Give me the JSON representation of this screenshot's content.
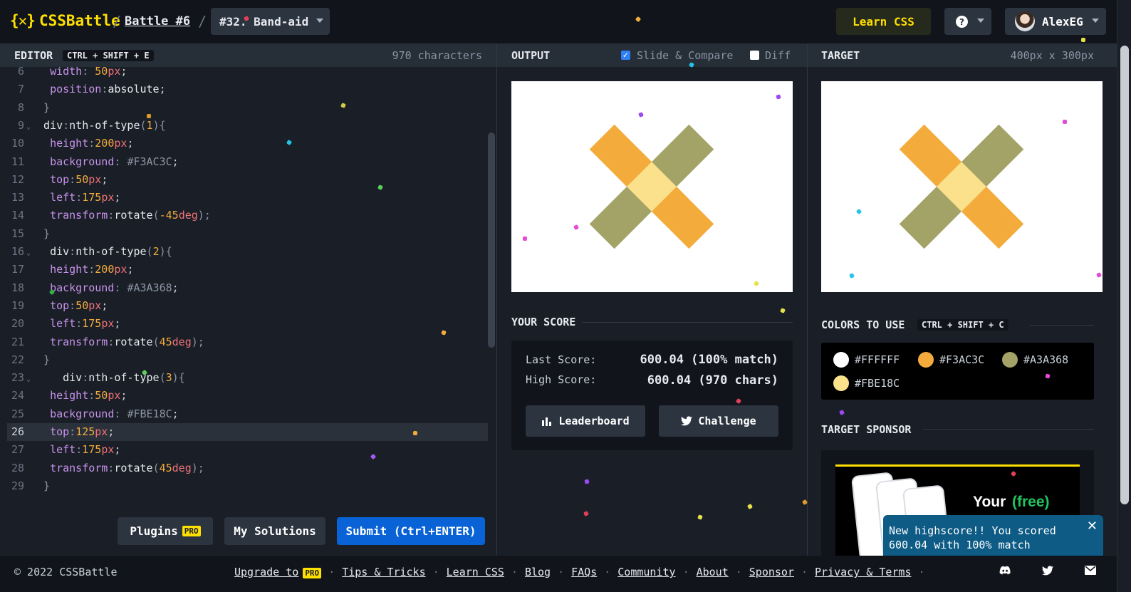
{
  "header": {
    "logo_text": "CSSBattle",
    "logo_mark": "{✕}",
    "battle_label": "Battle #6",
    "target_select": "#32. Band-aid",
    "learn_css": "Learn CSS",
    "help": "?",
    "user_name": "AlexEG"
  },
  "editor": {
    "title": "EDITOR",
    "shortcut": "CTRL + SHIFT + E",
    "char_count": "970 characters",
    "lines": [
      {
        "n": "6",
        "text": "  width: 50px;"
      },
      {
        "n": "7",
        "text": "  position:absolute;"
      },
      {
        "n": "8",
        "text": " }"
      },
      {
        "n": "9",
        "text": " div:nth-of-type(1){"
      },
      {
        "n": "10",
        "text": "  height:200px;"
      },
      {
        "n": "11",
        "text": "  background: #F3AC3C;"
      },
      {
        "n": "12",
        "text": "  top:50px;"
      },
      {
        "n": "13",
        "text": "  left:175px;"
      },
      {
        "n": "14",
        "text": "  transform:rotate(-45deg);"
      },
      {
        "n": "15",
        "text": " }"
      },
      {
        "n": "16",
        "text": "  div:nth-of-type(2){"
      },
      {
        "n": "17",
        "text": "  height:200px;"
      },
      {
        "n": "18",
        "text": "  background: #A3A368;"
      },
      {
        "n": "19",
        "text": "  top:50px;"
      },
      {
        "n": "20",
        "text": "  left:175px;"
      },
      {
        "n": "21",
        "text": "  transform:rotate(45deg);"
      },
      {
        "n": "22",
        "text": " }"
      },
      {
        "n": "23",
        "text": "    div:nth-of-type(3){"
      },
      {
        "n": "24",
        "text": "  height:50px;"
      },
      {
        "n": "25",
        "text": "  background: #FBE18C;"
      },
      {
        "n": "26",
        "text": "  top:125px;"
      },
      {
        "n": "27",
        "text": "  left:175px;"
      },
      {
        "n": "28",
        "text": "  transform:rotate(45deg);"
      },
      {
        "n": "29",
        "text": " }"
      }
    ],
    "plugins": "Plugins",
    "pro": "PRO",
    "my_solutions": "My Solutions",
    "submit": "Submit (Ctrl+ENTER)"
  },
  "output": {
    "title": "OUTPUT",
    "slide_compare": "Slide & Compare",
    "slide_checked": true,
    "diff": "Diff",
    "diff_checked": false
  },
  "target": {
    "title": "TARGET",
    "size": "400px x 300px"
  },
  "score": {
    "title": "YOUR SCORE",
    "last_label": "Last Score:",
    "last_value": "600.04 (100% match)",
    "high_label": "High Score:",
    "high_value": "600.04 (970 chars)",
    "leaderboard": "Leaderboard",
    "challenge": "Challenge"
  },
  "colors": {
    "title": "COLORS TO USE",
    "shortcut": "CTRL + SHIFT + C",
    "items": [
      {
        "hex": "#FFFFFF",
        "color": "#FFFFFF"
      },
      {
        "hex": "#F3AC3C",
        "color": "#F3AC3C"
      },
      {
        "hex": "#A3A368",
        "color": "#A3A368"
      },
      {
        "hex": "#FBE18C",
        "color": "#FBE18C"
      }
    ]
  },
  "sponsor": {
    "title": "TARGET SPONSOR",
    "ad_text": "Your",
    "ad_highlight": "(free)"
  },
  "toast": {
    "line1": "New highscore!! You scored",
    "line2": "600.04 with 100% match",
    "close": "✕"
  },
  "footer": {
    "copyright": "© 2022 CSSBattle",
    "links": [
      "Upgrade to",
      "Tips & Tricks",
      "Learn CSS",
      "Blog",
      "FAQs",
      "Community",
      "About",
      "Sponsor",
      "Privacy & Terms"
    ],
    "pro": "PRO"
  },
  "theme": {
    "accent": "#ffdf00",
    "submit_blue": "#0a63d6",
    "band_orange": "#F3AC3C",
    "band_olive": "#A3A368",
    "band_center": "#FBE18C"
  }
}
